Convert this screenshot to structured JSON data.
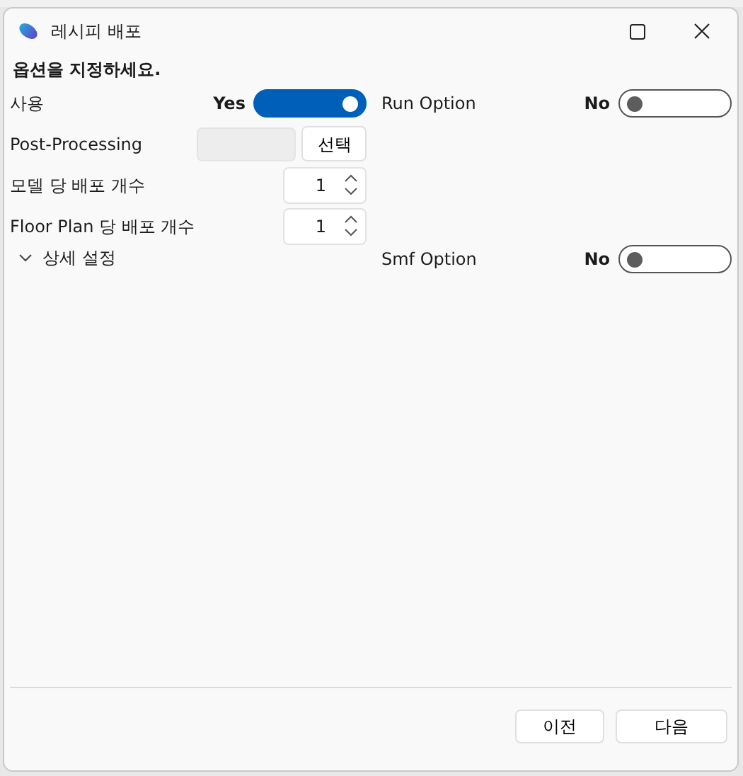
{
  "window": {
    "title": "레시피 배포"
  },
  "heading": "옵션을 지정하세요.",
  "left_options": [
    {
      "kind": "toggle",
      "label": "사용",
      "state_text": "Yes",
      "on": true
    },
    {
      "kind": "file",
      "label": "Post-Processing",
      "button": "선택"
    },
    {
      "kind": "spinner",
      "label": "모델 당 배포 개수",
      "value": "1"
    },
    {
      "kind": "spinner",
      "label": "Floor Plan 당 배포 개수",
      "value": "1"
    },
    {
      "kind": "expander",
      "label": "상세 설정",
      "expanded": false
    }
  ],
  "right_options": [
    {
      "kind": "toggle",
      "label": "Run Option",
      "state_text": "No",
      "on": false
    },
    {
      "kind": "gap"
    },
    {
      "kind": "gap"
    },
    {
      "kind": "gap"
    },
    {
      "kind": "toggle",
      "label": "Smf Option",
      "state_text": "No",
      "on": false
    }
  ],
  "buttons": [
    {
      "label": "이전"
    },
    {
      "label": "다음"
    }
  ]
}
